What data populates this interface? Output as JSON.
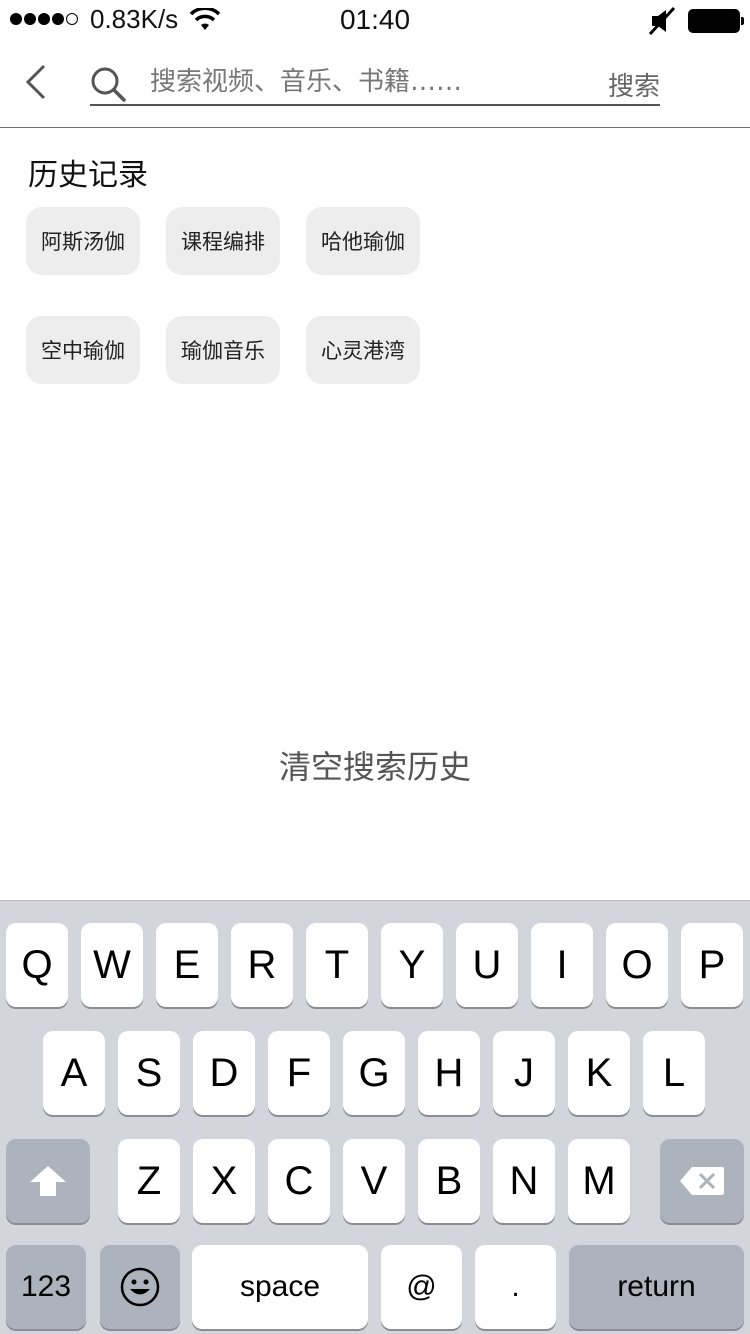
{
  "status_bar": {
    "network_speed": "0.83K/s",
    "time": "01:40"
  },
  "search": {
    "placeholder": "搜索视频、音乐、书籍……",
    "button_label": "搜索"
  },
  "history": {
    "title": "历史记录",
    "items": [
      "阿斯汤伽",
      "课程编排",
      "哈他瑜伽",
      "空中瑜伽",
      "瑜伽音乐",
      "心灵港湾"
    ],
    "clear_label": "清空搜索历史"
  },
  "keyboard": {
    "row1": [
      "Q",
      "W",
      "E",
      "R",
      "T",
      "Y",
      "U",
      "I",
      "O",
      "P"
    ],
    "row2": [
      "A",
      "S",
      "D",
      "F",
      "G",
      "H",
      "J",
      "K",
      "L"
    ],
    "row3": [
      "Z",
      "X",
      "C",
      "V",
      "B",
      "N",
      "M"
    ],
    "numbers_label": "123",
    "space_label": "space",
    "at_label": "@",
    "period_label": ".",
    "return_label": "return"
  }
}
